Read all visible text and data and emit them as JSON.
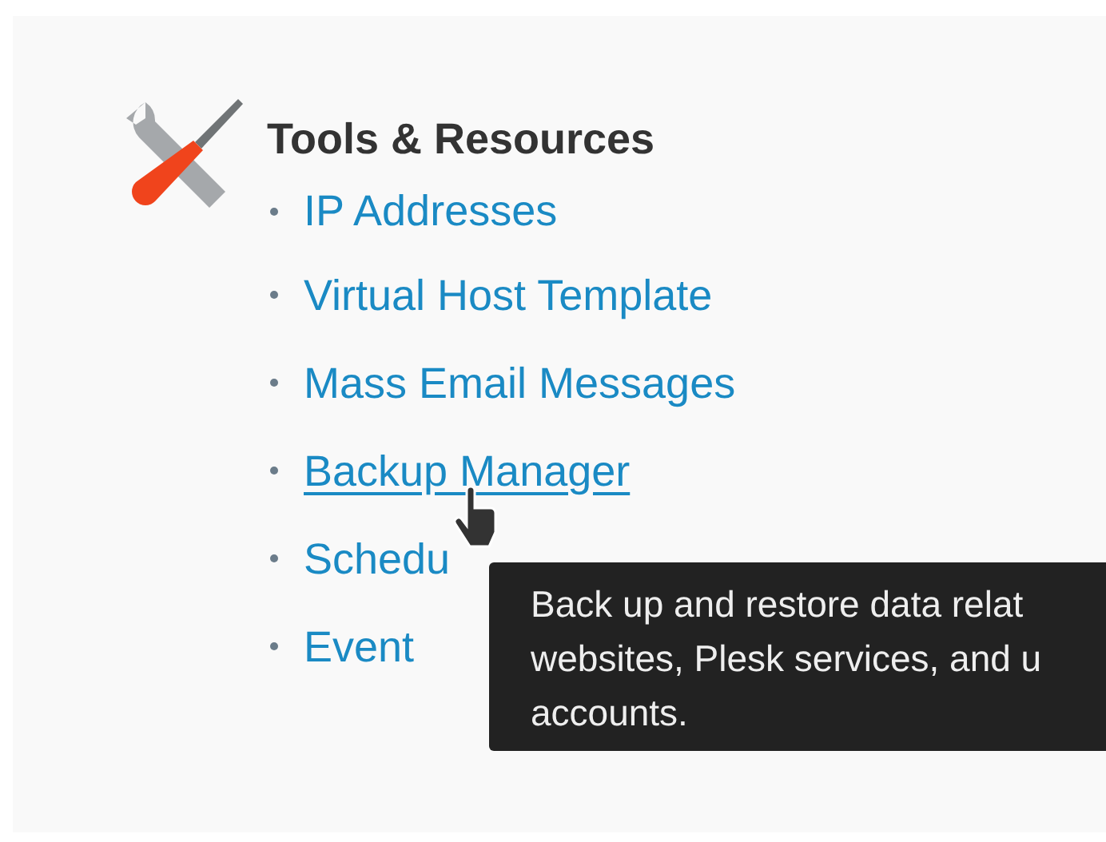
{
  "section": {
    "title": "Tools & Resources"
  },
  "links": [
    {
      "label": "IP Addresses",
      "hovered": false
    },
    {
      "label": "Virtual Host Template",
      "hovered": false
    },
    {
      "label": "Mass Email Messages",
      "hovered": false
    },
    {
      "label": "Backup Manager",
      "hovered": true
    },
    {
      "label": "Schedu",
      "hovered": false
    },
    {
      "label": "Event",
      "hovered": false
    }
  ],
  "tooltip": {
    "text": "Back up and restore data relat\nwebsites, Plesk services, and u\naccounts."
  }
}
